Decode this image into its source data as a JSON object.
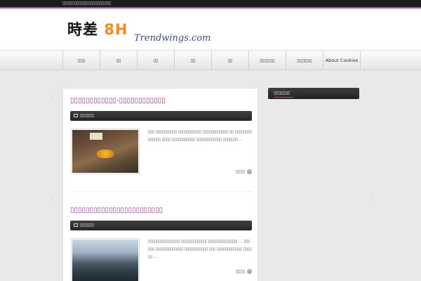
{
  "topbar": {
    "text": "▯▯▯▯▯▯▯▯▯▯▯▯▯▯▯▯▯▯▯▯▯"
  },
  "header": {
    "logo_main_a": "時差",
    "logo_main_b": "8H",
    "logo_sub": "Trendwings.com"
  },
  "nav": {
    "items": [
      "▯▯▯",
      "▯▯",
      "▯▯",
      "▯▯",
      "▯▯",
      "▯▯▯▯▯▯",
      "▯▯▯▯▯▯",
      "About Cookies"
    ]
  },
  "posts": [
    {
      "title": "▯▯▯▯▯▯▯▯▯▯▯▯-▯▯▯▯▯▯▯▯▯▯▯▯",
      "category": "▯▯▯▯▯▯",
      "excerpt": "▯▯▯ ▯▯▯▯▯▯▯▯▯▯ ▯▯▯▯▯▯▯▯▯▯▯ ▯▯▯▯▯▯▯▯▯▯▯▯ ▯▯ ▯▯▯▯▯▯▯▯ ▯▯▯▯▯▯ ▯▯▯▯ ▯▯▯▯▯▯▯▯▯▯▯ ▯▯▯▯▯▯▯▯▯▯▯▯ ▯▯▯▯▯▯▯ ...",
      "more": "▯▯▯▯"
    },
    {
      "title": "▯▯▯▯▯▯▯▯▯▯▯▯▯▯▯▯▯▯▯▯▯▯▯▯",
      "category": "▯▯▯▯▯▯",
      "excerpt": "▯▯▯▯▯▯▯▯▯▯▯▯▯▯▯ ▯▯▯▯▯▯▯▯▯▯▯▯ ▯▯▯▯▯▯▯▯▯▯▯▯▯▯ ... ▯▯▯▯▯▯ ▯▯▯▯▯▯▯▯▯▯▯▯▯ ▯▯▯▯▯▯▯▯▯▯▯ ▯▯▯ ▯▯▯▯▯▯▯▯▯▯▯▯ ▯▯▯▯▯▯ ...",
      "more": "▯▯▯▯"
    }
  ],
  "sidebar": {
    "title": "▯▯▯▯▯▯▯"
  },
  "colors": {
    "accent": "#c23fb2",
    "link": "#8b3a8b",
    "logo_number": "#f08a24"
  },
  "icons": {
    "category": "comment-icon",
    "more": "arrow-right-circle-icon"
  }
}
